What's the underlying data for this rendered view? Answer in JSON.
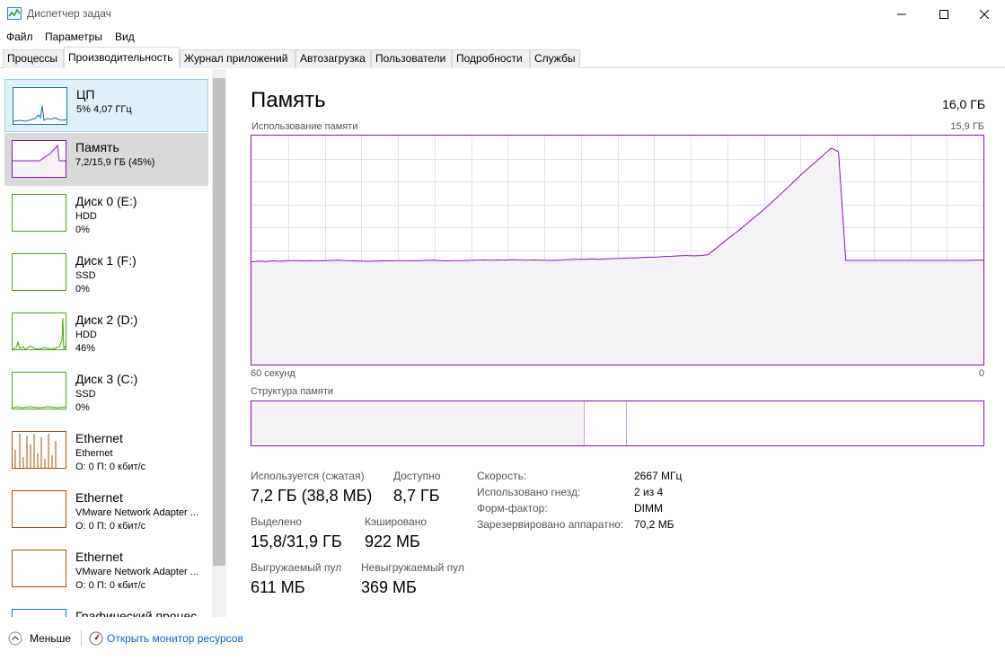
{
  "window": {
    "title": "Диспетчер задач"
  },
  "menu": [
    "Файл",
    "Параметры",
    "Вид"
  ],
  "tabs": [
    "Процессы",
    "Производительность",
    "Журнал приложений",
    "Автозагрузка",
    "Пользователи",
    "Подробности",
    "Службы"
  ],
  "active_tab": "Производительность",
  "sidebar": {
    "items": [
      {
        "name": "ЦП",
        "lines": [
          "5% 4,07 ГГц"
        ],
        "color": "#1174aa",
        "icon": "cpu-graph"
      },
      {
        "name": "Память",
        "lines": [
          "7,2/15,9 ГБ (45%)"
        ],
        "color": "#8b12ae",
        "icon": "memory-graph"
      },
      {
        "name": "Диск 0 (E:)",
        "lines": [
          "HDD",
          "0%"
        ],
        "color": "#4da60c",
        "icon": "disk-graph"
      },
      {
        "name": "Диск 1 (F:)",
        "lines": [
          "SSD",
          "0%"
        ],
        "color": "#4da60c",
        "icon": "disk-graph"
      },
      {
        "name": "Диск 2 (D:)",
        "lines": [
          "HDD",
          "46%"
        ],
        "color": "#4da60c",
        "icon": "disk-graph"
      },
      {
        "name": "Диск 3 (C:)",
        "lines": [
          "SSD",
          "0%"
        ],
        "color": "#4da60c",
        "icon": "disk-graph"
      },
      {
        "name": "Ethernet",
        "lines": [
          "Ethernet",
          "О: 0 П: 0 кбит/с"
        ],
        "color": "#a74f01",
        "icon": "network-graph"
      },
      {
        "name": "Ethernet",
        "lines": [
          "VMware Network Adapter ...",
          "О: 0 П: 0 кбит/с"
        ],
        "color": "#a74f01",
        "icon": "network-graph"
      },
      {
        "name": "Ethernet",
        "lines": [
          "VMware Network Adapter ...",
          "О: 0 П: 0 кбит/с"
        ],
        "color": "#a74f01",
        "icon": "network-graph"
      },
      {
        "name": "Графический процес",
        "lines": [],
        "color": "#1174aa",
        "icon": "gpu-graph"
      }
    ]
  },
  "main": {
    "title": "Память",
    "total": "16,0 ГБ",
    "graph_label": "Использование памяти",
    "graph_max": "15,9 ГБ",
    "time_left": "60 секунд",
    "time_right": "0",
    "structure_label": "Структура памяти",
    "structure": {
      "in_use_fraction": 0.455,
      "modified_fraction": 0.0,
      "standby_fraction": 0.056
    },
    "usage_series_percent": [
      44.9,
      45.2,
      45.0,
      45.3,
      45.1,
      45.4,
      45.4,
      45.3,
      45.4,
      45.3,
      45.4,
      45.5,
      45.6,
      45.4,
      45.3,
      45.2,
      45.1,
      45.2,
      45.3,
      45.3,
      45.4,
      45.4,
      45.3,
      45.4,
      45.5,
      45.6,
      45.4,
      45.3,
      45.4,
      45.4,
      45.5,
      45.6,
      45.7,
      45.6,
      45.7,
      45.6,
      45.8,
      45.7,
      45.6,
      45.7,
      45.6,
      45.5,
      45.5,
      45.7,
      45.9,
      46.0,
      46.0,
      46.1,
      46.0,
      46.2,
      46.3,
      46.4,
      46.6,
      46.6,
      46.8,
      46.9,
      47.0,
      47.2,
      47.3,
      47.5,
      47.6,
      47.5,
      47.6,
      48.0,
      50.5,
      53.1,
      55.6,
      58.0,
      60.6,
      63.3,
      65.9,
      68.6,
      71.5,
      74.4,
      77.3,
      80.4,
      83.4,
      86.2,
      88.9,
      91.8,
      94.5,
      93.0,
      45.5,
      45.5,
      45.5,
      45.5,
      45.5,
      45.5,
      45.5,
      45.5,
      45.5,
      45.5,
      45.5,
      45.5,
      45.5,
      45.5,
      45.5,
      45.5,
      45.5,
      45.5,
      45.6,
      45.6
    ],
    "stats": [
      {
        "label": "Используется (сжатая)",
        "value": "7,2 ГБ (38,8 МБ)"
      },
      {
        "label": "Доступно",
        "value": "8,7 ГБ"
      },
      {
        "label": "Выделено",
        "value": "15,8/31,9 ГБ"
      },
      {
        "label": "Кэшировано",
        "value": "922 МБ"
      },
      {
        "label": "Выгружаемый пул",
        "value": "611 МБ"
      },
      {
        "label": "Невыгружаемый пул",
        "value": "369 МБ"
      }
    ],
    "details": [
      {
        "label": "Скорость:",
        "value": "2667 МГц"
      },
      {
        "label": "Использовано гнезд:",
        "value": "2 из 4"
      },
      {
        "label": "Форм-фактор:",
        "value": "DIMM"
      },
      {
        "label": "Зарезервировано аппаратно:",
        "value": "70,2 МБ"
      }
    ]
  },
  "footer": {
    "less_label": "Меньше",
    "monitor_link": "Открыть монитор ресурсов"
  },
  "colors": {
    "memory": "#8b12ae",
    "memory_fill": "#f4f2f5",
    "grid": "#e9dcef"
  }
}
